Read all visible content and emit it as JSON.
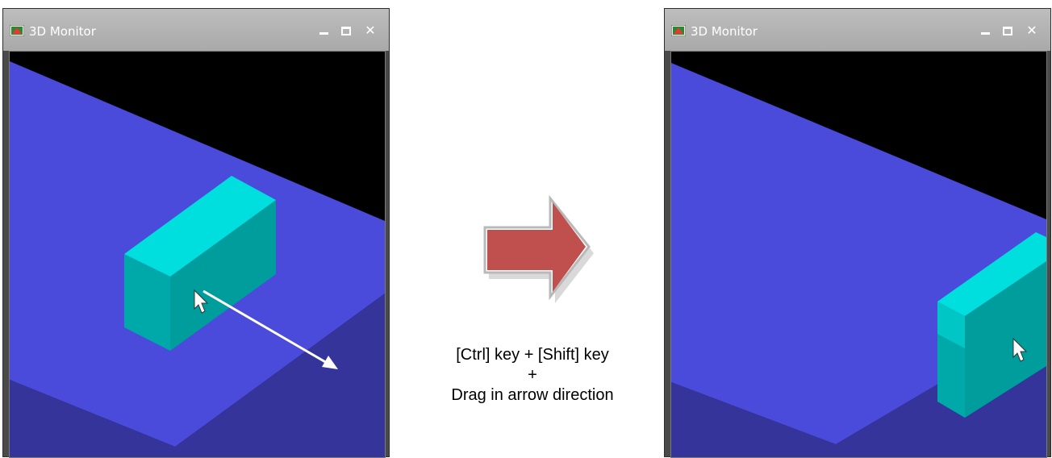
{
  "windows": [
    {
      "title": "3D Monitor",
      "controls": {
        "minimize": "minimize-icon",
        "maximize": "maximize-icon",
        "close": "close-icon"
      }
    },
    {
      "title": "3D Monitor",
      "controls": {
        "minimize": "minimize-icon",
        "maximize": "maximize-icon",
        "close": "close-icon"
      }
    }
  ],
  "instruction": {
    "line1": "[Ctrl] key + [Shift] key",
    "line2": "+",
    "line3": "Drag in arrow direction"
  },
  "colors": {
    "plate_top": "#4a4adb",
    "plate_side": "#34349a",
    "block_top": "#00dede",
    "block_side": "#00a3a3",
    "background": "#000000",
    "arrow_red": "#c0504d"
  }
}
